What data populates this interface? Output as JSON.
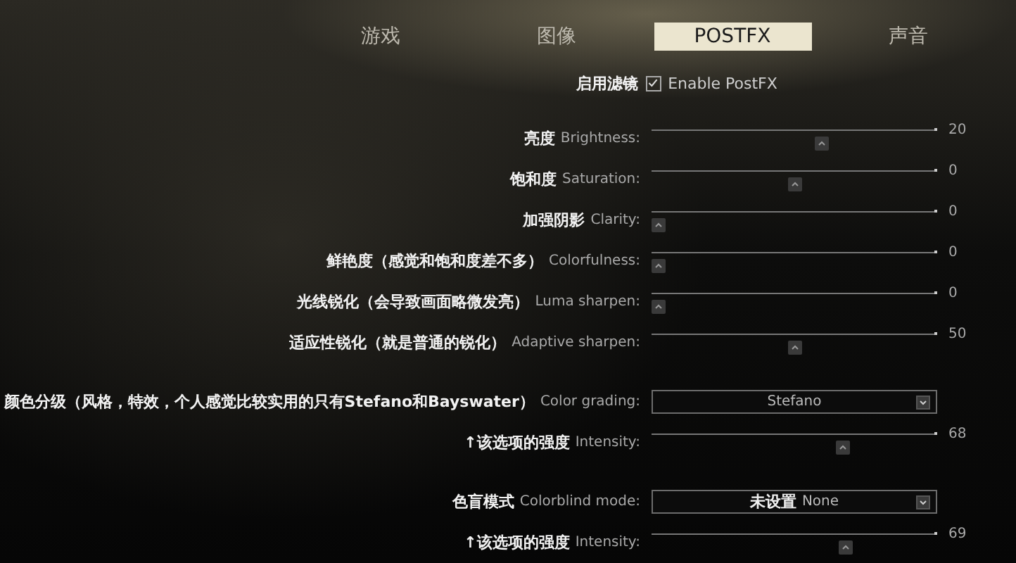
{
  "tabs": [
    {
      "label": "游戏",
      "selected": false
    },
    {
      "label": "图像",
      "selected": false
    },
    {
      "label": "POSTFX",
      "selected": true
    },
    {
      "label": "声音",
      "selected": false
    }
  ],
  "enable_postfx": {
    "label_zh": "启用滤镜",
    "label_en": "Enable PostFX",
    "checked": true
  },
  "settings": [
    {
      "kind": "slider",
      "label_zh": "亮度",
      "label_en": "Brightness:",
      "level": 0.6,
      "reading": "20"
    },
    {
      "kind": "slider",
      "label_zh": "饱和度",
      "label_en": "Saturation:",
      "level": 0.5,
      "reading": "0"
    },
    {
      "kind": "slider",
      "label_zh": "加强阴影",
      "label_en": "Clarity:",
      "level": 0,
      "reading": "0"
    },
    {
      "kind": "slider",
      "label_zh": "鲜艳度（感觉和饱和度差不多）",
      "label_en": "Colorfulness:",
      "level": 0,
      "reading": "0"
    },
    {
      "kind": "slider",
      "label_zh": "光线锐化（会导致画面略微发亮）",
      "label_en": "Luma sharpen:",
      "level": 0,
      "reading": "0"
    },
    {
      "kind": "slider",
      "label_zh": "适应性锐化（就是普通的锐化）",
      "label_en": "Adaptive sharpen:",
      "level": 0.5,
      "reading": "50"
    },
    {
      "kind": "dropdown",
      "label_zh": "颜色分级（风格，特效，个人感觉比较实用的只有Stefano和Bayswater）",
      "label_en": "Color grading:",
      "value": "Stefano"
    },
    {
      "kind": "slider",
      "label_zh": "↑该选项的强度",
      "label_en": "Intensity:",
      "level": 0.68,
      "reading": "68"
    },
    {
      "kind": "dropdown",
      "label_zh": "色盲模式",
      "label_en": "Colorblind mode:",
      "value_zh": "未设置",
      "value": "None"
    },
    {
      "kind": "slider",
      "label_zh": "↑该选项的强度",
      "label_en": "Intensity:",
      "level": 0.69,
      "reading": "69"
    }
  ]
}
